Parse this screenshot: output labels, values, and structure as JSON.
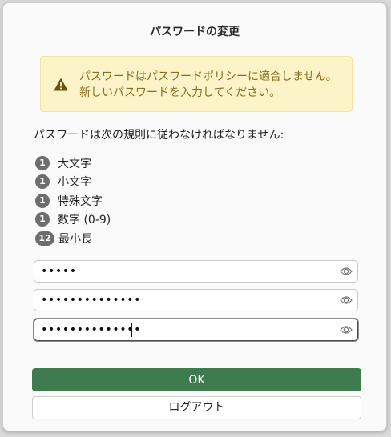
{
  "dialog": {
    "title": "パスワードの変更",
    "warning": {
      "icon": "warning-triangle-icon",
      "text": "パスワードはパスワードポリシーに適合しません。新しいパスワードを入力してください。"
    },
    "rules_intro": "パスワードは次の規則に従わなければなりません:",
    "rules": [
      {
        "count": "1",
        "label": "大文字"
      },
      {
        "count": "1",
        "label": "小文字"
      },
      {
        "count": "1",
        "label": "特殊文字"
      },
      {
        "count": "1",
        "label": "数字 (0-9)"
      },
      {
        "count": "12",
        "label": "最小長"
      }
    ],
    "fields": {
      "current_password": {
        "value": "•••••",
        "icon": "eye-icon"
      },
      "new_password": {
        "value": "••••••••••••••",
        "icon": "eye-icon"
      },
      "confirm_password": {
        "value": "••••••••••••••",
        "icon": "eye-icon"
      }
    },
    "ok_label": "OK",
    "logout_label": "ログアウト"
  },
  "colors": {
    "ok_button": "#3e7b4d",
    "warning_bg": "#fcf3c8",
    "warning_text": "#8a6d1e",
    "badge": "#6d6d6d"
  }
}
